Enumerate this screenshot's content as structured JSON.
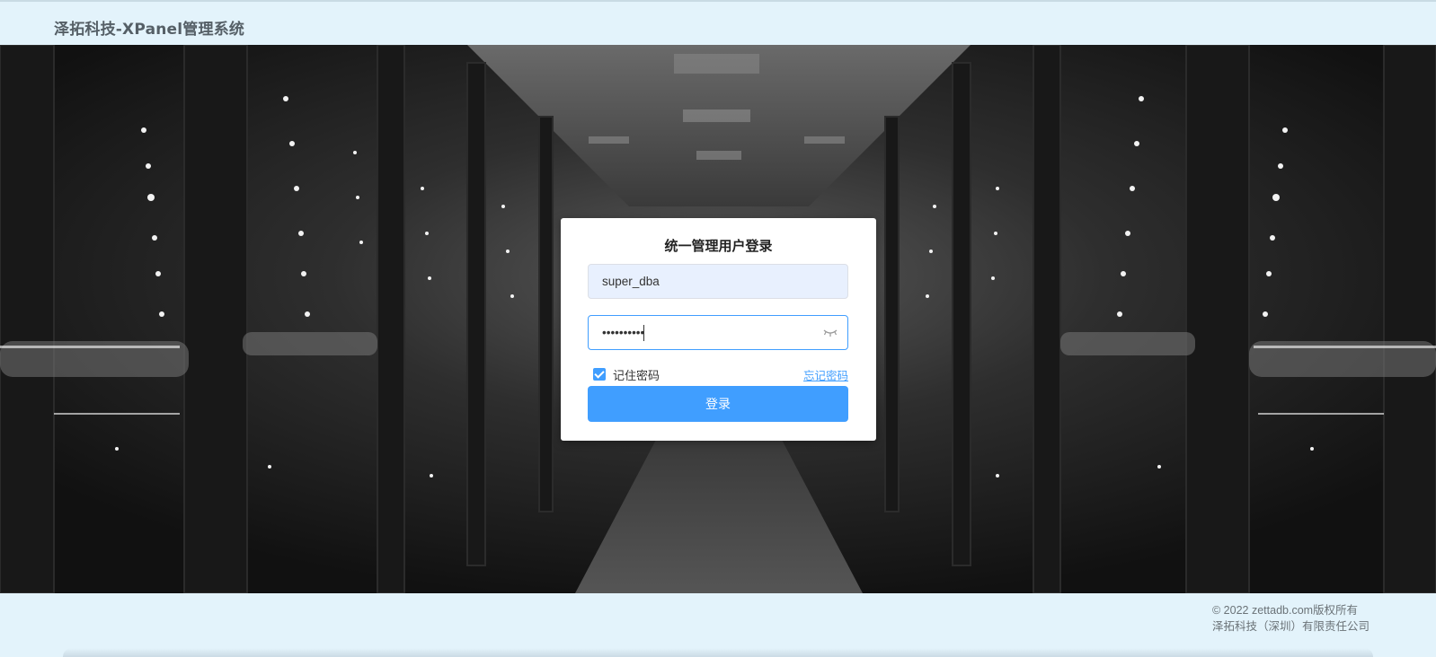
{
  "header": {
    "title": "泽拓科技-XPanel管理系统"
  },
  "login": {
    "title": "统一管理用户登录",
    "username_value": "super_dba",
    "password_value": "••••••••••",
    "remember_label": "记住密码",
    "remember_checked": true,
    "forgot_label": "忘记密码",
    "submit_label": "登录"
  },
  "footer": {
    "copyright": "© 2022 zettadb.com版权所有",
    "company": "泽拓科技（深圳）有限责任公司"
  },
  "colors": {
    "accent": "#409eff",
    "header_bg": "#e3f3fb"
  },
  "icons": {
    "password_toggle": "eye-closed-icon"
  }
}
